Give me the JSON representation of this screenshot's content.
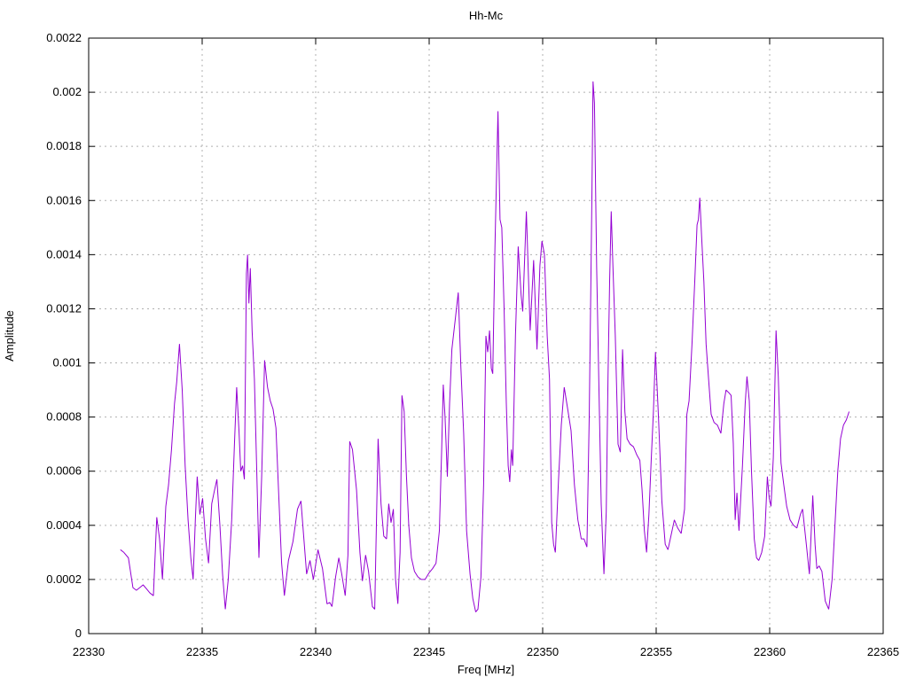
{
  "title": "Hh-Mc",
  "chart_data": {
    "type": "line",
    "title": "Hh-Mc",
    "xlabel": "Freq [MHz]",
    "ylabel": "Amplitude",
    "xlim": [
      22330,
      22365
    ],
    "ylim": [
      0,
      0.0022
    ],
    "xtick_values": [
      22330,
      22335,
      22340,
      22345,
      22350,
      22355,
      22360,
      22365
    ],
    "xtick_labels": [
      "22330",
      "22335",
      "22340",
      "22345",
      "22350",
      "22355",
      "22360",
      "22365"
    ],
    "ytick_values": [
      0,
      0.0002,
      0.0004,
      0.0006,
      0.0008,
      0.001,
      0.0012,
      0.0014,
      0.0016,
      0.0018,
      0.002,
      0.0022
    ],
    "ytick_labels": [
      "0",
      "0.0002",
      "0.0004",
      "0.0006",
      "0.0008",
      "0.001",
      "0.0012",
      "0.0014",
      "0.0016",
      "0.0018",
      "0.002",
      "0.0022"
    ],
    "grid": true,
    "legend": "none",
    "line_color": "#9400d3",
    "series": [
      {
        "name": "Hh-Mc",
        "points": [
          [
            22331.4,
            0.00031
          ],
          [
            22331.55,
            0.0003
          ],
          [
            22331.75,
            0.00028
          ],
          [
            22331.95,
            0.00017
          ],
          [
            22332.1,
            0.00016
          ],
          [
            22332.25,
            0.00017
          ],
          [
            22332.4,
            0.00018
          ],
          [
            22332.55,
            0.000165
          ],
          [
            22332.7,
            0.00015
          ],
          [
            22332.85,
            0.00014
          ],
          [
            22333.0,
            0.00043
          ],
          [
            22333.12,
            0.00035
          ],
          [
            22333.25,
            0.0002
          ],
          [
            22333.4,
            0.00047
          ],
          [
            22333.52,
            0.00055
          ],
          [
            22333.65,
            0.00068
          ],
          [
            22333.78,
            0.00085
          ],
          [
            22333.88,
            0.00093
          ],
          [
            22334.0,
            0.00107
          ],
          [
            22334.12,
            0.0009
          ],
          [
            22334.25,
            0.00062
          ],
          [
            22334.38,
            0.00042
          ],
          [
            22334.5,
            0.00028
          ],
          [
            22334.6,
            0.0002
          ],
          [
            22334.7,
            0.00042
          ],
          [
            22334.78,
            0.00058
          ],
          [
            22334.9,
            0.00044
          ],
          [
            22335.02,
            0.0005
          ],
          [
            22335.15,
            0.00035
          ],
          [
            22335.28,
            0.00026
          ],
          [
            22335.42,
            0.00048
          ],
          [
            22335.52,
            0.00052
          ],
          [
            22335.65,
            0.00057
          ],
          [
            22335.78,
            0.0004
          ],
          [
            22335.9,
            0.00022
          ],
          [
            22336.02,
            9e-05
          ],
          [
            22336.15,
            0.0002
          ],
          [
            22336.3,
            0.00042
          ],
          [
            22336.42,
            0.0007
          ],
          [
            22336.52,
            0.00091
          ],
          [
            22336.62,
            0.00075
          ],
          [
            22336.7,
            0.0006
          ],
          [
            22336.78,
            0.00062
          ],
          [
            22336.86,
            0.00057
          ],
          [
            22336.95,
            0.00133
          ],
          [
            22337.0,
            0.0014
          ],
          [
            22337.06,
            0.00122
          ],
          [
            22337.12,
            0.00135
          ],
          [
            22337.2,
            0.00112
          ],
          [
            22337.3,
            0.00094
          ],
          [
            22337.4,
            0.00062
          ],
          [
            22337.5,
            0.00028
          ],
          [
            22337.62,
            0.00058
          ],
          [
            22337.75,
            0.00101
          ],
          [
            22337.88,
            0.00091
          ],
          [
            22338.0,
            0.00086
          ],
          [
            22338.12,
            0.00083
          ],
          [
            22338.25,
            0.00076
          ],
          [
            22338.38,
            0.0005
          ],
          [
            22338.5,
            0.00026
          ],
          [
            22338.62,
            0.00014
          ],
          [
            22338.8,
            0.00027
          ],
          [
            22339.0,
            0.00034
          ],
          [
            22339.2,
            0.00046
          ],
          [
            22339.35,
            0.00049
          ],
          [
            22339.48,
            0.00035
          ],
          [
            22339.6,
            0.00022
          ],
          [
            22339.75,
            0.00027
          ],
          [
            22339.9,
            0.0002
          ],
          [
            22340.1,
            0.00031
          ],
          [
            22340.3,
            0.00024
          ],
          [
            22340.5,
            0.00011
          ],
          [
            22340.62,
            0.000115
          ],
          [
            22340.72,
            0.0001
          ],
          [
            22340.88,
            0.00021
          ],
          [
            22341.02,
            0.00028
          ],
          [
            22341.15,
            0.00022
          ],
          [
            22341.3,
            0.00014
          ],
          [
            22341.42,
            0.00029
          ],
          [
            22341.5,
            0.00071
          ],
          [
            22341.62,
            0.00068
          ],
          [
            22341.8,
            0.00053
          ],
          [
            22341.95,
            0.0003
          ],
          [
            22342.06,
            0.000194
          ],
          [
            22342.2,
            0.00029
          ],
          [
            22342.33,
            0.00023
          ],
          [
            22342.5,
            0.0001
          ],
          [
            22342.6,
            9e-05
          ],
          [
            22342.75,
            0.00072
          ],
          [
            22342.88,
            0.00048
          ],
          [
            22343.0,
            0.00036
          ],
          [
            22343.12,
            0.00035
          ],
          [
            22343.22,
            0.00048
          ],
          [
            22343.32,
            0.00041
          ],
          [
            22343.42,
            0.00046
          ],
          [
            22343.52,
            0.0002
          ],
          [
            22343.62,
            0.00011
          ],
          [
            22343.72,
            0.0003
          ],
          [
            22343.8,
            0.00088
          ],
          [
            22343.9,
            0.00082
          ],
          [
            22344.0,
            0.00058
          ],
          [
            22344.1,
            0.0004
          ],
          [
            22344.22,
            0.00028
          ],
          [
            22344.35,
            0.00023
          ],
          [
            22344.5,
            0.00021
          ],
          [
            22344.65,
            0.0002
          ],
          [
            22344.82,
            0.0002
          ],
          [
            22345.0,
            0.000225
          ],
          [
            22345.15,
            0.00024
          ],
          [
            22345.3,
            0.00026
          ],
          [
            22345.45,
            0.00038
          ],
          [
            22345.55,
            0.00068
          ],
          [
            22345.62,
            0.00092
          ],
          [
            22345.7,
            0.0008
          ],
          [
            22345.8,
            0.00058
          ],
          [
            22345.9,
            0.00085
          ],
          [
            22346.0,
            0.00105
          ],
          [
            22346.15,
            0.00116
          ],
          [
            22346.28,
            0.00126
          ],
          [
            22346.4,
            0.00098
          ],
          [
            22346.52,
            0.00074
          ],
          [
            22346.65,
            0.00038
          ],
          [
            22346.8,
            0.00022
          ],
          [
            22346.92,
            0.00013
          ],
          [
            22347.05,
            8e-05
          ],
          [
            22347.15,
            9e-05
          ],
          [
            22347.28,
            0.00021
          ],
          [
            22347.4,
            0.00055
          ],
          [
            22347.5,
            0.0011
          ],
          [
            22347.58,
            0.00104
          ],
          [
            22347.66,
            0.00112
          ],
          [
            22347.74,
            0.00098
          ],
          [
            22347.8,
            0.00096
          ],
          [
            22347.9,
            0.00143
          ],
          [
            22348.03,
            0.00193
          ],
          [
            22348.12,
            0.00153
          ],
          [
            22348.2,
            0.0015
          ],
          [
            22348.3,
            0.0012
          ],
          [
            22348.4,
            0.00085
          ],
          [
            22348.48,
            0.00062
          ],
          [
            22348.55,
            0.00056
          ],
          [
            22348.62,
            0.00068
          ],
          [
            22348.68,
            0.00062
          ],
          [
            22348.8,
            0.0011
          ],
          [
            22348.92,
            0.00143
          ],
          [
            22349.05,
            0.00125
          ],
          [
            22349.12,
            0.00119
          ],
          [
            22349.28,
            0.00156
          ],
          [
            22349.45,
            0.00112
          ],
          [
            22349.6,
            0.00138
          ],
          [
            22349.75,
            0.00105
          ],
          [
            22349.88,
            0.00136
          ],
          [
            22349.97,
            0.00145
          ],
          [
            22350.08,
            0.0014
          ],
          [
            22350.2,
            0.0011
          ],
          [
            22350.3,
            0.00094
          ],
          [
            22350.4,
            0.00041
          ],
          [
            22350.48,
            0.00033
          ],
          [
            22350.56,
            0.0003
          ],
          [
            22350.7,
            0.00057
          ],
          [
            22350.82,
            0.00077
          ],
          [
            22350.95,
            0.00091
          ],
          [
            22351.1,
            0.00083
          ],
          [
            22351.25,
            0.00075
          ],
          [
            22351.4,
            0.00055
          ],
          [
            22351.55,
            0.00042
          ],
          [
            22351.7,
            0.00035
          ],
          [
            22351.82,
            0.00035
          ],
          [
            22351.95,
            0.00032
          ],
          [
            22352.05,
            0.0008
          ],
          [
            22352.12,
            0.00128
          ],
          [
            22352.17,
            0.00164
          ],
          [
            22352.22,
            0.00204
          ],
          [
            22352.28,
            0.00196
          ],
          [
            22352.38,
            0.00135
          ],
          [
            22352.48,
            0.0009
          ],
          [
            22352.58,
            0.00048
          ],
          [
            22352.7,
            0.00022
          ],
          [
            22352.8,
            0.00045
          ],
          [
            22352.88,
            0.00095
          ],
          [
            22352.95,
            0.0013
          ],
          [
            22353.02,
            0.00156
          ],
          [
            22353.1,
            0.00134
          ],
          [
            22353.2,
            0.0011
          ],
          [
            22353.32,
            0.0007
          ],
          [
            22353.42,
            0.00067
          ],
          [
            22353.52,
            0.00105
          ],
          [
            22353.62,
            0.00082
          ],
          [
            22353.72,
            0.00072
          ],
          [
            22353.85,
            0.0007
          ],
          [
            22354.0,
            0.00069
          ],
          [
            22354.15,
            0.00066
          ],
          [
            22354.28,
            0.00064
          ],
          [
            22354.38,
            0.00053
          ],
          [
            22354.48,
            0.00038
          ],
          [
            22354.58,
            0.0003
          ],
          [
            22354.68,
            0.00044
          ],
          [
            22354.78,
            0.00064
          ],
          [
            22354.88,
            0.00082
          ],
          [
            22354.97,
            0.00104
          ],
          [
            22355.1,
            0.0008
          ],
          [
            22355.25,
            0.00049
          ],
          [
            22355.4,
            0.00033
          ],
          [
            22355.52,
            0.00031
          ],
          [
            22355.65,
            0.00036
          ],
          [
            22355.8,
            0.00042
          ],
          [
            22355.95,
            0.00039
          ],
          [
            22356.1,
            0.00037
          ],
          [
            22356.25,
            0.00046
          ],
          [
            22356.35,
            0.00081
          ],
          [
            22356.45,
            0.00086
          ],
          [
            22356.58,
            0.00107
          ],
          [
            22356.7,
            0.0013
          ],
          [
            22356.8,
            0.00151
          ],
          [
            22356.86,
            0.00153
          ],
          [
            22356.92,
            0.00161
          ],
          [
            22357.0,
            0.00147
          ],
          [
            22357.1,
            0.0013
          ],
          [
            22357.2,
            0.00107
          ],
          [
            22357.3,
            0.00095
          ],
          [
            22357.42,
            0.00081
          ],
          [
            22357.55,
            0.00078
          ],
          [
            22357.7,
            0.00077
          ],
          [
            22357.85,
            0.00074
          ],
          [
            22357.98,
            0.00085
          ],
          [
            22358.08,
            0.0009
          ],
          [
            22358.2,
            0.00089
          ],
          [
            22358.3,
            0.00088
          ],
          [
            22358.4,
            0.0007
          ],
          [
            22358.48,
            0.00042
          ],
          [
            22358.56,
            0.00052
          ],
          [
            22358.65,
            0.00038
          ],
          [
            22358.8,
            0.00062
          ],
          [
            22358.92,
            0.00085
          ],
          [
            22359.0,
            0.00095
          ],
          [
            22359.1,
            0.00086
          ],
          [
            22359.2,
            0.0006
          ],
          [
            22359.32,
            0.00035
          ],
          [
            22359.42,
            0.00028
          ],
          [
            22359.52,
            0.00027
          ],
          [
            22359.65,
            0.0003
          ],
          [
            22359.78,
            0.00036
          ],
          [
            22359.9,
            0.00058
          ],
          [
            22359.98,
            0.0005
          ],
          [
            22360.06,
            0.00047
          ],
          [
            22360.16,
            0.00065
          ],
          [
            22360.28,
            0.00112
          ],
          [
            22360.38,
            0.00095
          ],
          [
            22360.5,
            0.00063
          ],
          [
            22360.62,
            0.00055
          ],
          [
            22360.75,
            0.00047
          ],
          [
            22360.9,
            0.00042
          ],
          [
            22361.05,
            0.0004
          ],
          [
            22361.2,
            0.00039
          ],
          [
            22361.35,
            0.00044
          ],
          [
            22361.45,
            0.00046
          ],
          [
            22361.6,
            0.00034
          ],
          [
            22361.75,
            0.00022
          ],
          [
            22361.9,
            0.00051
          ],
          [
            22362.0,
            0.00033
          ],
          [
            22362.08,
            0.00024
          ],
          [
            22362.18,
            0.00025
          ],
          [
            22362.3,
            0.00023
          ],
          [
            22362.45,
            0.00012
          ],
          [
            22362.6,
            9e-05
          ],
          [
            22362.75,
            0.0002
          ],
          [
            22362.85,
            0.00036
          ],
          [
            22363.0,
            0.0006
          ],
          [
            22363.12,
            0.00072
          ],
          [
            22363.25,
            0.00077
          ],
          [
            22363.38,
            0.00079
          ],
          [
            22363.5,
            0.00082
          ]
        ]
      }
    ]
  }
}
